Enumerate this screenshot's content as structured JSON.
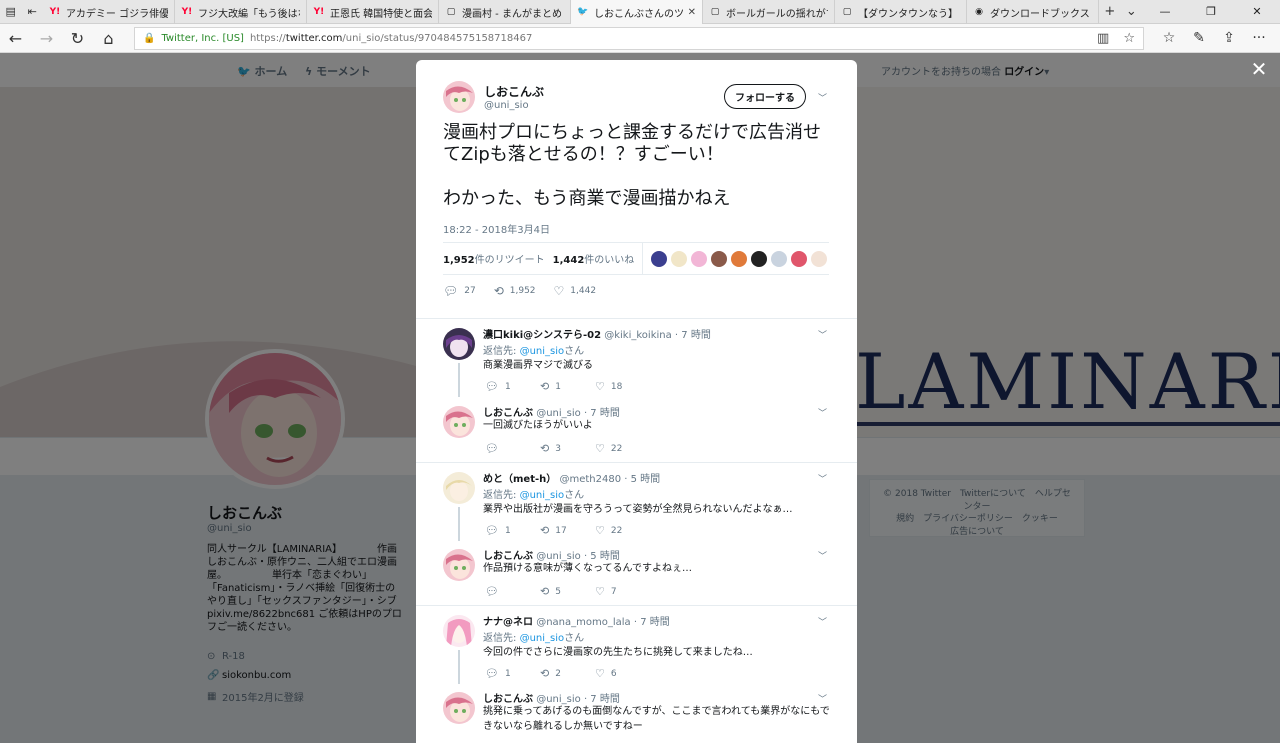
{
  "browser": {
    "tabs": [
      {
        "label": "アカデミー ゴジラ俳優を追悼 |",
        "favicon": "Y!",
        "color": "#ff0033"
      },
      {
        "label": "フジ大改編「もう後はない」|",
        "favicon": "Y!",
        "color": "#ff0033"
      },
      {
        "label": "正恩氏 韓国特使と面会決定",
        "favicon": "Y!",
        "color": "#ff0033"
      },
      {
        "label": "漫画村 - まんがまとめ・無料コ",
        "favicon": "▢",
        "color": "#444"
      },
      {
        "label": "しおこんぶさんのツイート: \"",
        "favicon": "🐦",
        "color": "#1da1f2"
      },
      {
        "label": "ボールガールの揺れがすごい【ブ",
        "favicon": "▢",
        "color": "#444"
      },
      {
        "label": "【ダウンタウンなう】 HIKAKIN",
        "favicon": "▢",
        "color": "#444"
      },
      {
        "label": "ダウンロードブックス | 同人誌な",
        "favicon": "◉",
        "color": "#333"
      }
    ],
    "url_org": "Twitter, Inc. [US]",
    "url_scheme": "https://",
    "url_host": "twitter.com",
    "url_path": "/uni_sio/status/970484575158718467"
  },
  "twitter_nav": {
    "home": "ホーム",
    "moments": "モーメント",
    "account_prefix": "アカウントをお持ちの場合",
    "login": "ログイン"
  },
  "banner_word": "LAMINARIA",
  "profile": {
    "name": "しおこんぶ",
    "handle": "@uni_sio",
    "bio": "同人サークル【LAMINARIA】　　　　作画しおこんぶ・原作ウニ、二人組でエロ漫画屋。　　　　　単行本「恋まぐわい」「Fanaticism」・ラノベ挿絵「回復術士のやり直し」「セックスファンタジー」・シブ pixiv.me/8622bnc681 ご依頼はHPのプロフご一読ください。",
    "location": "R-18",
    "website": "siokonbu.com",
    "joined": "2015年2月に登録"
  },
  "footer": {
    "line1": "© 2018 Twitter　Twitterについて　ヘルプセンター",
    "line2": "規約　プライバシーポリシー　クッキー",
    "line3": "広告について"
  },
  "tweet": {
    "name": "しおこんぶ",
    "handle": "@uni_sio",
    "follow_label": "フォローする",
    "text_1": "漫画村プロにちょっと課金するだけで広告消せてZipも落とせるの！？すごーい！",
    "text_2": "わかった、もう商業で漫画描かねえ",
    "time": "18:22 - 2018年3月4日",
    "retweets_num": "1,952",
    "retweets_label": "件のリツイート",
    "likes_num": "1,442",
    "likes_label": "件のいいね",
    "reply_count": "27",
    "retweet_count": "1,952",
    "like_count": "1,442"
  },
  "replies": [
    {
      "items": [
        {
          "name": "濃口kiki@シンステら-02",
          "handle": "@kiki_koikina",
          "time": "· 7 時間",
          "reply_to": "返信先:",
          "mention": "@uni_sio",
          "san": "さん",
          "text": "商業漫画界マジで滅びる",
          "replies": "1",
          "retweets": "1",
          "likes": "18"
        },
        {
          "name": "しおこんぶ",
          "handle": "@uni_sio",
          "time": "· 7 時間",
          "text": "一回滅びたほうがいいよ",
          "replies": "",
          "retweets": "3",
          "likes": "22"
        }
      ]
    },
    {
      "items": [
        {
          "name": "めと（met-h）",
          "handle": "@meth2480",
          "time": "· 5 時間",
          "reply_to": "返信先:",
          "mention": "@uni_sio",
          "san": "さん",
          "text": "業界や出版社が漫画を守ろうって姿勢が全然見られないんだよなぁ…",
          "replies": "1",
          "retweets": "17",
          "likes": "22"
        },
        {
          "name": "しおこんぶ",
          "handle": "@uni_sio",
          "time": "· 5 時間",
          "text": "作品預ける意味が薄くなってるんですよねぇ…",
          "replies": "",
          "retweets": "5",
          "likes": "7"
        }
      ]
    },
    {
      "items": [
        {
          "name": "ナナ@ネロ",
          "handle": "@nana_momo_lala",
          "time": "· 7 時間",
          "reply_to": "返信先:",
          "mention": "@uni_sio",
          "san": "さん",
          "text": "今回の件でさらに漫画家の先生たちに挑発して来ましたね…",
          "replies": "1",
          "retweets": "2",
          "likes": "6"
        },
        {
          "name": "しおこんぶ",
          "handle": "@uni_sio",
          "time": "· 7 時間",
          "text": "挑発に乗ってあげるのも面倒なんですが、ここまで言われても業界がなにもできないなら離れるしか無いですねー",
          "replies": "",
          "retweets": "",
          "likes": ""
        }
      ]
    }
  ],
  "colors": {
    "link": "#1b95e0",
    "twitter_blue": "#1da1f2",
    "text": "#14171a",
    "muted": "#657786"
  }
}
